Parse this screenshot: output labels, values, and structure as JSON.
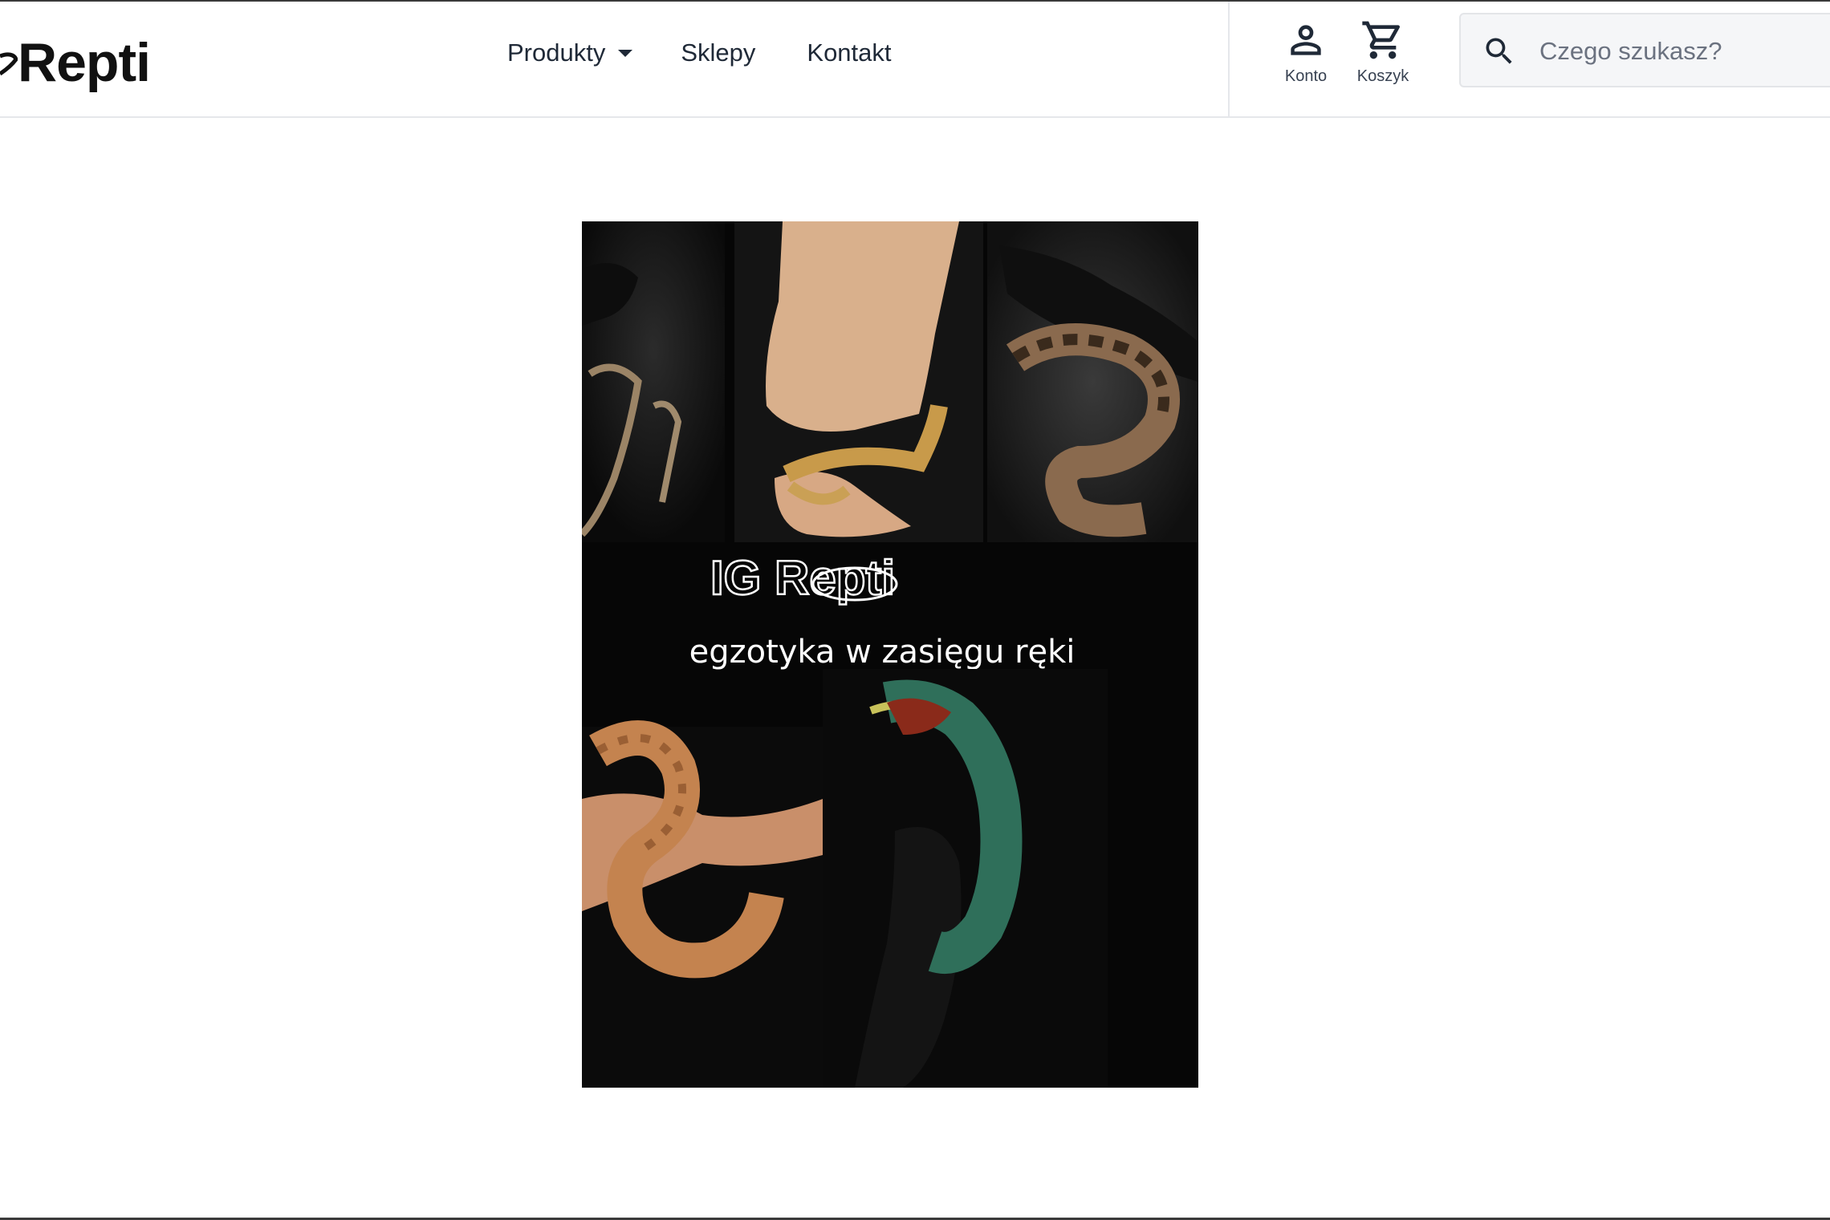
{
  "header": {
    "logo_text": "Repti",
    "nav": [
      {
        "label": "Produkty",
        "has_dropdown": true
      },
      {
        "label": "Sklepy"
      },
      {
        "label": "Kontakt"
      }
    ],
    "account": {
      "label": "Konto",
      "icon": "person-icon"
    },
    "cart": {
      "label": "Koszyk",
      "icon": "cart-icon"
    },
    "search": {
      "placeholder": "Czego szukasz?",
      "value": "",
      "icon": "search-icon"
    }
  },
  "banner": {
    "logo_text": "IG Repti",
    "tagline": "egzotyka w zasięgu ręki",
    "photos": [
      "geckos-on-glove",
      "crested-gecko-in-hand",
      "ball-python-on-glove",
      "hognose-snake-in-hand",
      "panther-chameleon-on-glove"
    ]
  }
}
